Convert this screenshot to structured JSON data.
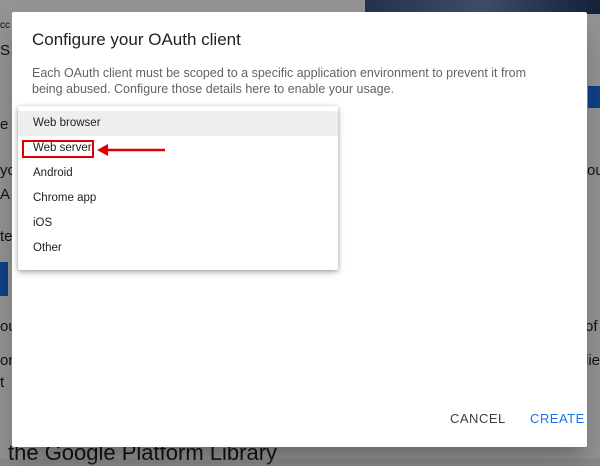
{
  "background": {
    "fragments": [
      "cc",
      "S",
      "e",
      "yc",
      "A",
      "te",
      "c",
      "ou",
      "on",
      "t",
      "ou",
      "of",
      "lie",
      "the Google Platform Library"
    ]
  },
  "dialog": {
    "title": "Configure your OAuth client",
    "description": "Each OAuth client must be scoped to a specific application environment to prevent it from being abused. Configure those details here to enable your usage.",
    "menu": {
      "items": [
        {
          "label": "Web browser",
          "selected": true
        },
        {
          "label": "Web server",
          "selected": false
        },
        {
          "label": "Android",
          "selected": false
        },
        {
          "label": "Chrome app",
          "selected": false
        },
        {
          "label": "iOS",
          "selected": false
        },
        {
          "label": "Other",
          "selected": false
        }
      ]
    },
    "actions": {
      "cancel": "CANCEL",
      "create": "CREATE"
    }
  },
  "annotation": {
    "color": "#e00000",
    "target": "Web server"
  },
  "colors": {
    "accent": "#1a73e8",
    "highlight": "#e00000"
  }
}
